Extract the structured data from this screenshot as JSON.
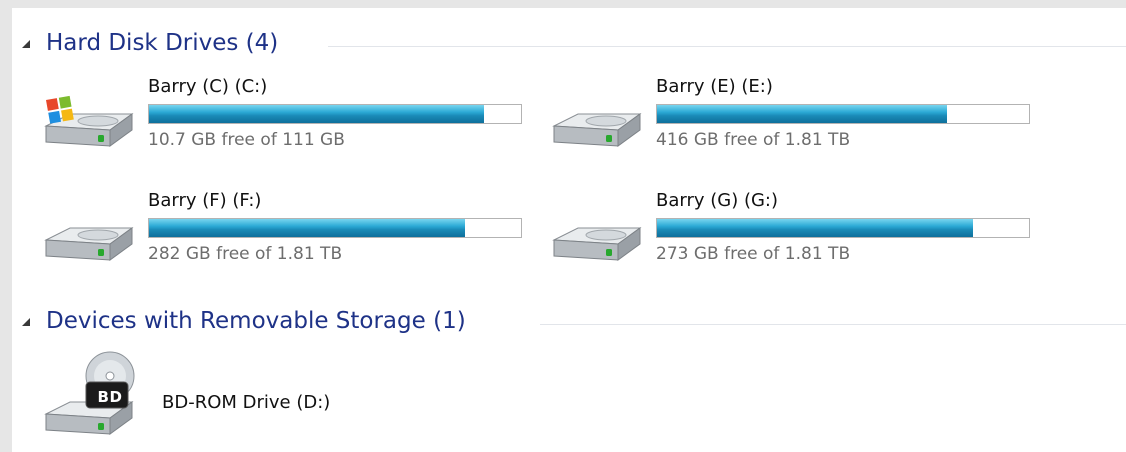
{
  "groups": {
    "hard_disks": {
      "title": "Hard Disk Drives (4)"
    },
    "removable": {
      "title": "Devices with Removable Storage (1)"
    }
  },
  "drives": [
    {
      "name": "Barry (C) (C:)",
      "free_text": "10.7 GB free of 111 GB",
      "used_fraction": 0.9,
      "icon": "windows-hard-drive-icon"
    },
    {
      "name": "Barry (E) (E:)",
      "free_text": "416 GB free of 1.81 TB",
      "used_fraction": 0.78,
      "icon": "hard-drive-icon"
    },
    {
      "name": "Barry (F) (F:)",
      "free_text": "282 GB free of 1.81 TB",
      "used_fraction": 0.85,
      "icon": "hard-drive-icon"
    },
    {
      "name": "Barry (G) (G:)",
      "free_text": "273 GB free of 1.81 TB",
      "used_fraction": 0.85,
      "icon": "hard-drive-icon"
    }
  ],
  "removable_devices": [
    {
      "name": "BD-ROM Drive (D:)",
      "badge": "BD",
      "icon": "bd-rom-drive-icon"
    }
  ],
  "colors": {
    "group_title": "#1e3287",
    "bar_fill": "#2ba9d5",
    "free_text": "#6d6d6d"
  }
}
